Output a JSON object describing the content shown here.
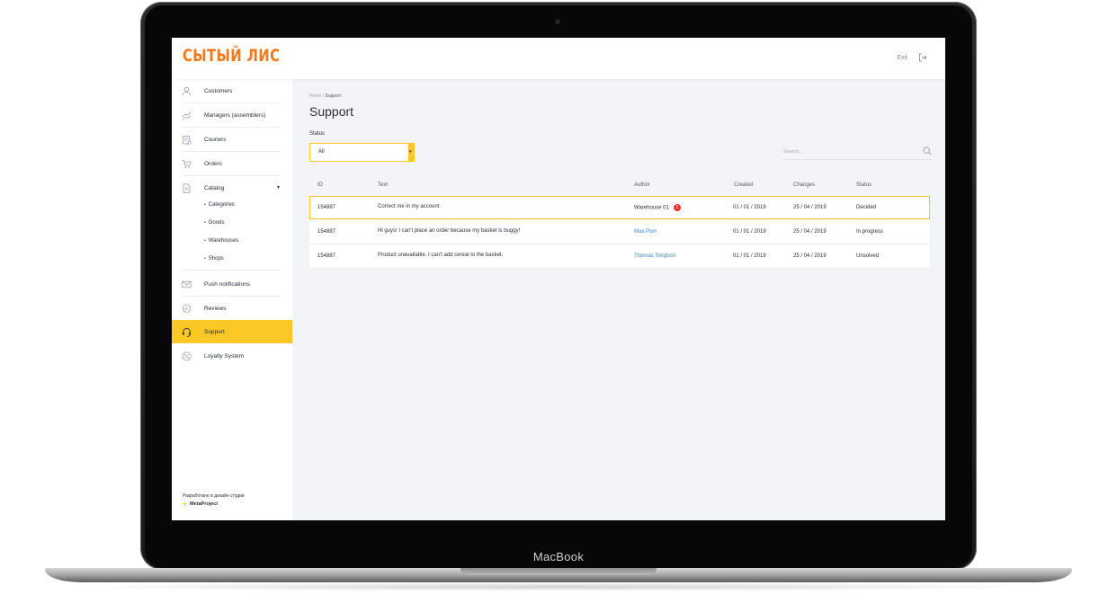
{
  "app": {
    "logo_text": "СЫТЫЙ ЛИС",
    "device_brand": "MacBook"
  },
  "header": {
    "exit_label": "Exit",
    "exit_icon": "logout-icon"
  },
  "sidebar": {
    "items": [
      {
        "label": "Customers",
        "icon": "user-icon"
      },
      {
        "label": "Managers (assemblers)",
        "icon": "hand-icon"
      },
      {
        "label": "Couriers",
        "icon": "clipboard-icon"
      },
      {
        "label": "Orders",
        "icon": "cart-icon"
      },
      {
        "label": "Catalog",
        "icon": "document-icon"
      },
      {
        "label": "Push notifications",
        "icon": "mail-icon"
      },
      {
        "label": "Reviews",
        "icon": "chat-icon"
      },
      {
        "label": "Support",
        "icon": "headset-icon"
      },
      {
        "label": "Loyalty System",
        "icon": "percent-icon"
      }
    ],
    "catalog_sub": [
      "Categories",
      "Goods",
      "Warehouses",
      "Shops"
    ],
    "footer_text": "Разработано в дизайн студии",
    "footer_brand": "MetaProject"
  },
  "breadcrumb": {
    "home": "Home",
    "separator": " / ",
    "current": "Support"
  },
  "page": {
    "title": "Support"
  },
  "filter": {
    "label": "Status",
    "value": "All"
  },
  "search": {
    "placeholder": "Search..."
  },
  "table": {
    "columns": [
      "ID",
      "Text",
      "Author",
      "Created",
      "Changes",
      "Status"
    ],
    "rows": [
      {
        "id": "154887",
        "text": "Correct me in my account.",
        "author": "Warehouse 01",
        "badge": "2",
        "created": "01 / 01 / 2019",
        "changes": "25 / 04 / 2019",
        "status": "Decided"
      },
      {
        "id": "154887",
        "text": "Hi guys! I can't place an order because my basket is buggy!",
        "author": "Max Poin",
        "created": "01 / 01 / 2019",
        "changes": "25 / 04 / 2019",
        "status": "In progress"
      },
      {
        "id": "154887",
        "text": "Product unavailable. I can't add cereal to the basket.",
        "author": "Thomas Simpson",
        "created": "01 / 01 / 2019",
        "changes": "25 / 04 / 2019",
        "status": "Unsolved"
      }
    ]
  },
  "colors": {
    "accent": "#fcc825",
    "logo": "#f07a1b",
    "link": "#3b86d6",
    "badge": "#e8352b",
    "background": "#f3f4f8"
  }
}
